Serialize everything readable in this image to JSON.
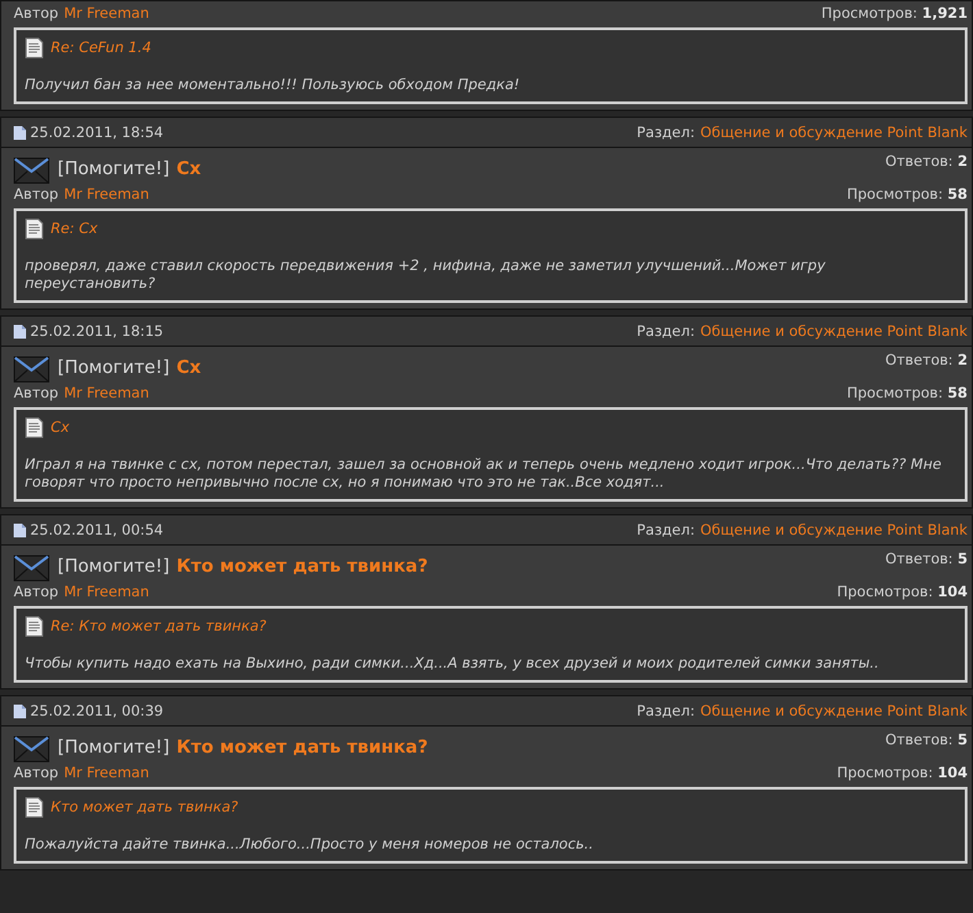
{
  "posts": [
    {
      "author_label": "Автор",
      "author": "Mr Freeman",
      "views_label": "Просмотров:",
      "views": "1,921",
      "quote_title": "Re: CeFun 1.4",
      "quote_text": "Получил бан за нее моментально!!! Пользуюсь обходом Предка!"
    },
    {
      "date": "25.02.2011, 18:54",
      "section_label": "Раздел:",
      "section": "Общение и обсуждение Point Blank",
      "prefix": "[Помогите!]",
      "title": "Cx",
      "replies_label": "Ответов:",
      "replies": "2",
      "author_label": "Автор",
      "author": "Mr Freeman",
      "views_label": "Просмотров:",
      "views": "58",
      "quote_title": "Re: Cx",
      "quote_text": "проверял, даже ставил скорость передвижения +2 , нифина, даже не заметил улучшений...Может игру переустановить?"
    },
    {
      "date": "25.02.2011, 18:15",
      "section_label": "Раздел:",
      "section": "Общение и обсуждение Point Blank",
      "prefix": "[Помогите!]",
      "title": "Cx",
      "replies_label": "Ответов:",
      "replies": "2",
      "author_label": "Автор",
      "author": "Mr Freeman",
      "views_label": "Просмотров:",
      "views": "58",
      "quote_title": "Cx",
      "quote_text": "Играл я на твинке с сх, потом перестал, зашел за основной ак и теперь очень медлено ходит игрок...Что делать?? Мне говорят что просто непривычно после сх, но я понимаю что это не так..Все ходят..."
    },
    {
      "date": "25.02.2011, 00:54",
      "section_label": "Раздел:",
      "section": "Общение и обсуждение Point Blank",
      "prefix": "[Помогите!]",
      "title": "Кто может дать твинка?",
      "replies_label": "Ответов:",
      "replies": "5",
      "author_label": "Автор",
      "author": "Mr Freeman",
      "views_label": "Просмотров:",
      "views": "104",
      "quote_title": "Re: Кто может дать твинка?",
      "quote_text": "Чтобы купить надо ехать на Выхино, ради симки...Хд...А взять, у всех друзей и моих родителей симки заняты.."
    },
    {
      "date": "25.02.2011, 00:39",
      "section_label": "Раздел:",
      "section": "Общение и обсуждение Point Blank",
      "prefix": "[Помогите!]",
      "title": "Кто может дать твинка?",
      "replies_label": "Ответов:",
      "replies": "5",
      "author_label": "Автор",
      "author": "Mr Freeman",
      "views_label": "Просмотров:",
      "views": "104",
      "quote_title": "Кто может дать твинка?",
      "quote_text": "Пожалуйста дайте твинка...Любого...Просто у меня номеров не осталось.."
    }
  ]
}
